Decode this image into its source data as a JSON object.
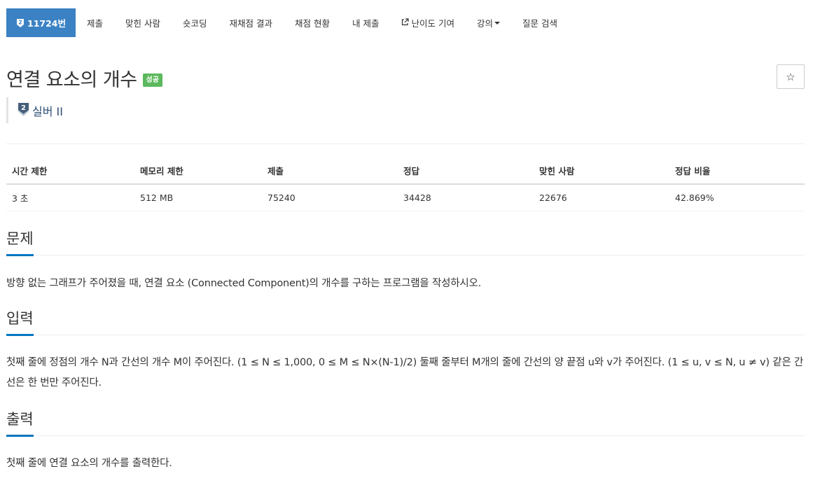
{
  "nav": {
    "problem_id": "11724번",
    "items": [
      {
        "label": "제출"
      },
      {
        "label": "맞힌 사람"
      },
      {
        "label": "숏코딩"
      },
      {
        "label": "재채점 결과"
      },
      {
        "label": "채점 현황"
      },
      {
        "label": "내 제출"
      },
      {
        "label": "난이도 기여"
      },
      {
        "label": "강의"
      },
      {
        "label": "질문 검색"
      }
    ]
  },
  "problem": {
    "title": "연결 요소의 개수",
    "result_label": "성공",
    "star": "☆",
    "tier": "실버 II",
    "tier_number": "2"
  },
  "info": {
    "headers": [
      "시간 제한",
      "메모리 제한",
      "제출",
      "정답",
      "맞힌 사람",
      "정답 비율"
    ],
    "values": [
      "3 초",
      "512 MB",
      "75240",
      "34428",
      "22676",
      "42.869%"
    ]
  },
  "sections": {
    "description": {
      "title": "문제",
      "text": "방향 없는 그래프가 주어졌을 때, 연결 요소 (Connected Component)의 개수를 구하는 프로그램을 작성하시오."
    },
    "input": {
      "title": "입력",
      "text": "첫째 줄에 정점의 개수 N과 간선의 개수 M이 주어진다. (1 ≤ N ≤ 1,000, 0 ≤ M ≤ N×(N-1)/2) 둘째 줄부터 M개의 줄에 간선의 양 끝점 u와 v가 주어진다. (1 ≤ u, v ≤ N, u ≠ v) 같은 간선은 한 번만 주어진다."
    },
    "output": {
      "title": "출력",
      "text": "첫째 줄에 연결 요소의 개수를 출력한다."
    }
  },
  "colors": {
    "nav_active": "#3a82c4",
    "result_success": "#5cb85c",
    "section_underline": "#0076c0",
    "tier_text": "#2d4c74"
  }
}
